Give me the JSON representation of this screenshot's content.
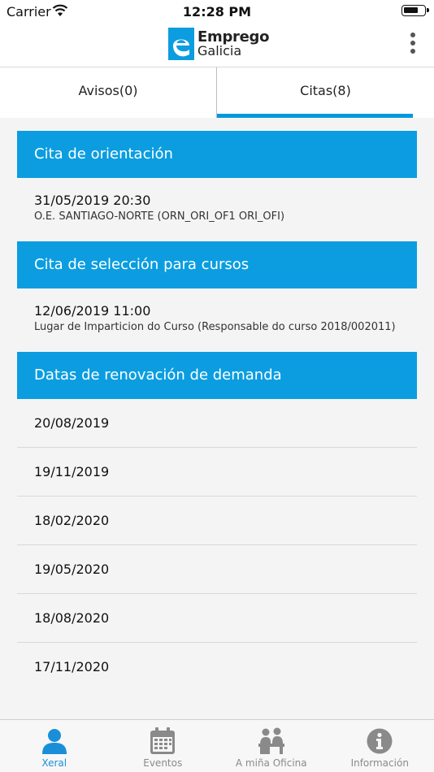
{
  "status_bar": {
    "carrier": "Carrier",
    "time": "12:28 PM"
  },
  "header": {
    "logo_line1": "Emprego",
    "logo_line2": "Galicia",
    "brand_color": "#0b9de0"
  },
  "tabs": [
    {
      "label": "Avisos(0)",
      "selected": false
    },
    {
      "label": "Citas(8)",
      "selected": true
    }
  ],
  "sections": {
    "orientacion": {
      "title": "Cita de orientación",
      "date": "31/05/2019 20:30",
      "place": "O.E. SANTIAGO-NORTE (ORN_ORI_OF1 ORI_OFI)"
    },
    "seleccion": {
      "title": "Cita de selección para cursos",
      "date": "12/06/2019 11:00",
      "place": "Lugar de Imparticion do Curso (Responsable do curso 2018/002011)"
    },
    "renovacion": {
      "title": "Datas de renovación de demanda",
      "dates": [
        "20/08/2019",
        "19/11/2019",
        "18/02/2020",
        "19/05/2020",
        "18/08/2020",
        "17/11/2020"
      ]
    }
  },
  "bottom_tabs": [
    {
      "label": "Xeral",
      "icon": "user-icon",
      "active": true
    },
    {
      "label": "Eventos",
      "icon": "calendar-icon",
      "active": false
    },
    {
      "label": "A miña Oficina",
      "icon": "office-icon",
      "active": false
    },
    {
      "label": "Información",
      "icon": "info-icon",
      "active": false
    }
  ],
  "colors": {
    "accent": "#0b9de0",
    "active_tab": "#1a8fd8",
    "inactive_tab": "#8a8a8a"
  }
}
